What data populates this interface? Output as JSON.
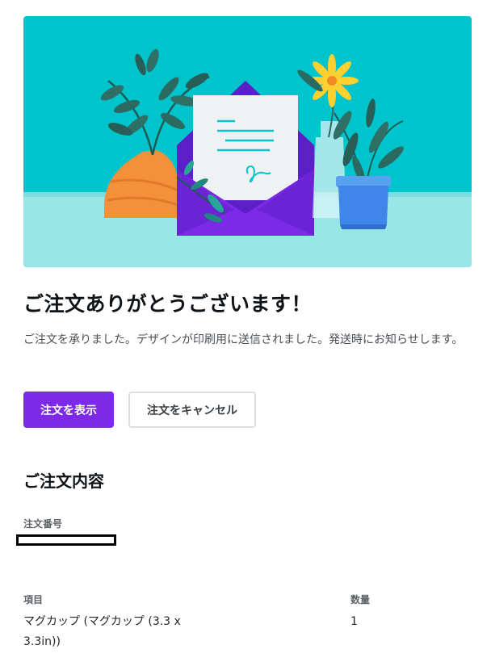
{
  "hero": {
    "illustration": "envelope-letter-plants-illustration",
    "colors": {
      "background": "#00c4cc",
      "envelope": "#7d2ae8",
      "floor": "#98e6e8"
    }
  },
  "confirmation": {
    "title": "ご注文ありがとうございます！",
    "message": "ご注文を承りました。デザインが印刷用に送信されました。発送時にお知らせします。"
  },
  "actions": {
    "view_order": "注文を表示",
    "cancel_order": "注文をキャンセル"
  },
  "details": {
    "section_title": "ご注文内容",
    "order_number_label": "注文番号",
    "columns": {
      "item": "項目",
      "quantity": "数量"
    },
    "items": [
      {
        "name": "マグカップ (マグカップ (3.3 x 3.3in))",
        "quantity": "1"
      }
    ]
  },
  "colors": {
    "primary": "#7d2ae8",
    "text": "#0e1318"
  }
}
